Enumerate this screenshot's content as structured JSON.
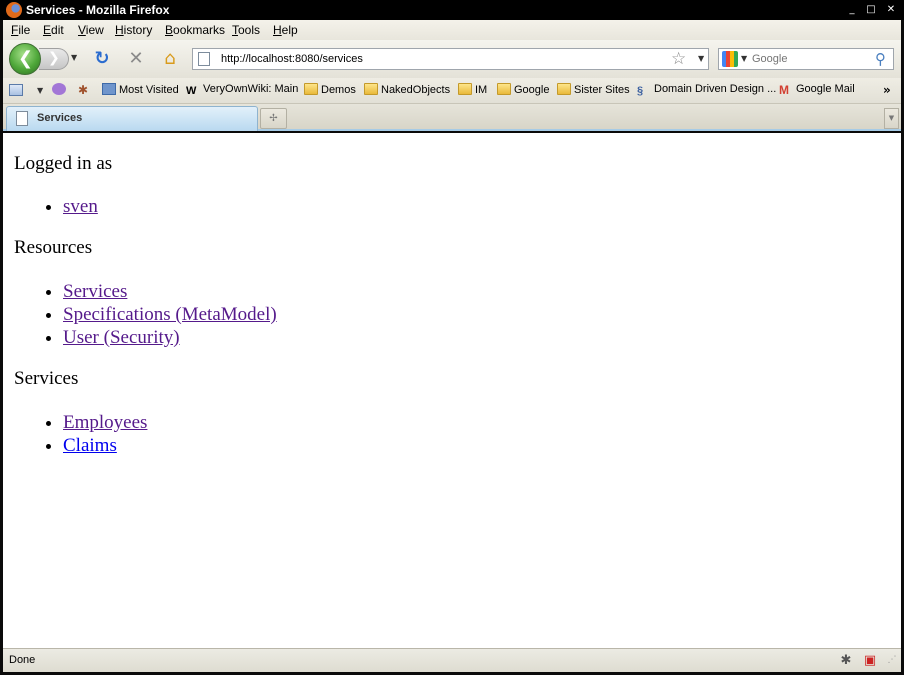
{
  "window": {
    "title": "Services - Mozilla Firefox",
    "minimize_glyph": "_",
    "maximize_glyph": "□",
    "close_glyph": "✕"
  },
  "menu": [
    "File",
    "Edit",
    "View",
    "History",
    "Bookmarks",
    "Tools",
    "Help"
  ],
  "navigation": {
    "url": "http://localhost:8080/services",
    "search_placeholder": "Google"
  },
  "bookmarks": [
    {
      "label": "Most Visited",
      "icon": "most-visited-icon"
    },
    {
      "label": "VeryOwnWiki: Main",
      "icon": "wiki-icon"
    },
    {
      "label": "Demos",
      "icon": "folder-icon"
    },
    {
      "label": "NakedObjects",
      "icon": "folder-icon"
    },
    {
      "label": "IM",
      "icon": "folder-icon"
    },
    {
      "label": "Google",
      "icon": "folder-icon"
    },
    {
      "label": "Sister Sites",
      "icon": "folder-icon"
    },
    {
      "label": "Domain Driven Design ...",
      "icon": "ddd-icon"
    },
    {
      "label": "Google Mail",
      "icon": "gmail-icon"
    }
  ],
  "tabs": [
    {
      "label": "Services",
      "active": true
    }
  ],
  "content": {
    "logged_in_heading": "Logged in as",
    "user_link": "sven",
    "resources_heading": "Resources",
    "resources": [
      "Services",
      "Specifications (MetaModel)",
      "User (Security)"
    ],
    "services_heading": "Services",
    "services": [
      "Employees",
      "Claims"
    ]
  },
  "status": {
    "text": "Done"
  },
  "colors": {
    "visited_link": "#551a8b",
    "unvisited_link": "#0000ee"
  }
}
